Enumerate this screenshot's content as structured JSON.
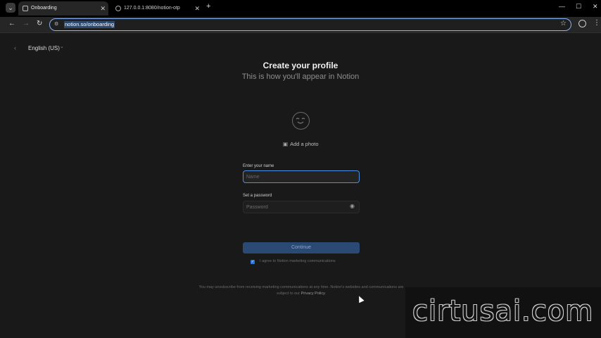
{
  "browser": {
    "tabs": [
      {
        "title": "Onboarding",
        "active": true
      },
      {
        "title": "127.0.0.1:8080/notion-otp",
        "active": false
      }
    ],
    "new_tab_glyph": "+",
    "window_controls": {
      "minimize": "—",
      "maximize": "☐",
      "close": "✕"
    },
    "nav": {
      "back": "←",
      "forward": "→",
      "reload": "↻"
    },
    "url": "notion.so/onboarding",
    "icons": {
      "tab_menu": "chevron-down-icon",
      "star": "star-icon",
      "profile": "profile-icon",
      "menu": "kebab-menu-icon"
    }
  },
  "page": {
    "language": "English (US)",
    "title": "Create your profile",
    "subtitle": "This is how you'll appear in Notion",
    "add_photo": "Add a photo",
    "name_label": "Enter your name",
    "name_placeholder": "Name",
    "password_label": "Set a password",
    "password_placeholder": "Password",
    "continue_label": "Continue",
    "marketing_checkbox": {
      "checked": true,
      "label": "I agree to Notion marketing communications"
    },
    "fine_print": "You may unsubscribe from receiving marketing communications at any time. Notion's websites and communications are subject to our",
    "privacy_link": "Privacy Policy",
    "fine_print_end": "."
  },
  "watermark": "cirtusai.com",
  "colors": {
    "accent": "#4a8fe0",
    "button": "#2a4a73",
    "background": "#191919"
  }
}
